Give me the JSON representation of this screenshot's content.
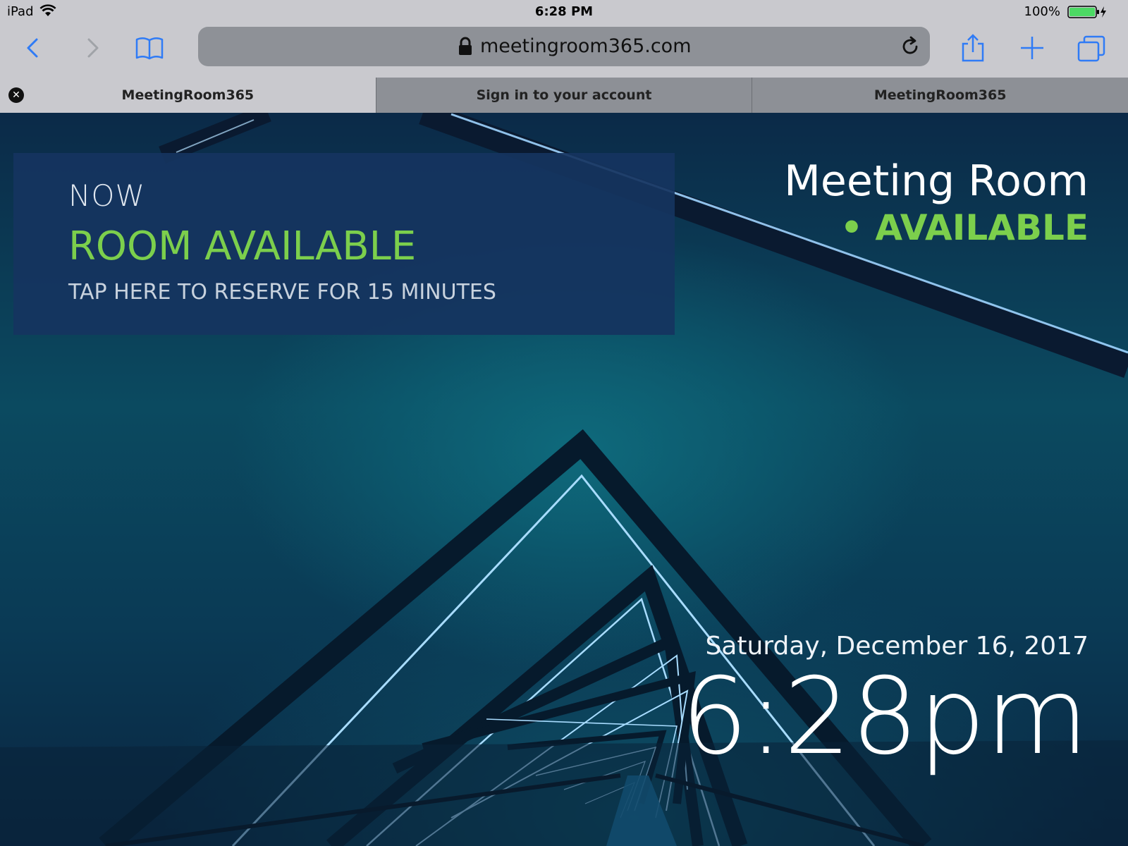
{
  "statusbar": {
    "device": "iPad",
    "time": "6:28 PM",
    "battery": "100%",
    "battery_color": "#4cd964"
  },
  "toolbar": {
    "url": "meetingroom365.com",
    "accent": "#2f7bf6"
  },
  "tabs": [
    {
      "label": "MeetingRoom365",
      "active": true
    },
    {
      "label": "Sign in to your account",
      "active": false
    },
    {
      "label": "MeetingRoom365",
      "active": false
    }
  ],
  "card": {
    "now_label": "NOW",
    "status": "ROOM AVAILABLE",
    "action": "TAP HERE TO RESERVE FOR 15 MINUTES"
  },
  "room": {
    "name": "Meeting Room",
    "availability": "• AVAILABLE",
    "status_color": "#7ccf4c"
  },
  "clock": {
    "date": "Saturday, December 16, 2017",
    "time": "6:28pm"
  }
}
